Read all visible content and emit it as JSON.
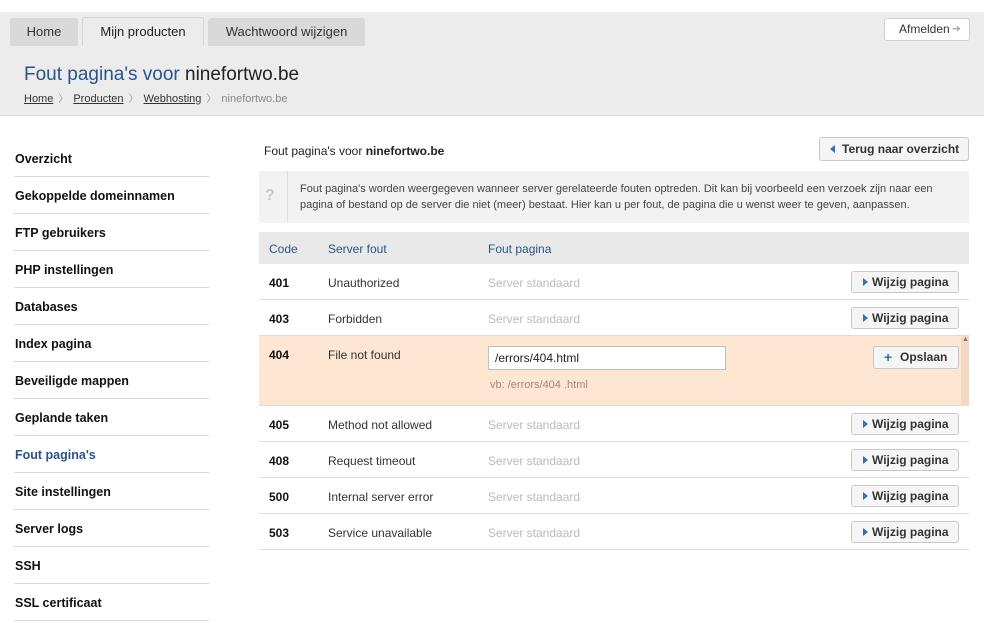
{
  "nav": {
    "tabs": [
      {
        "label": "Home"
      },
      {
        "label": "Mijn producten"
      },
      {
        "label": "Wachtwoord wijzigen"
      }
    ],
    "logout_label": "Afmelden"
  },
  "header": {
    "title_prefix": "Fout pagina's voor ",
    "title_domain": "ninefortwo.be",
    "breadcrumb": [
      "Home",
      "Producten",
      "Webhosting",
      "ninefortwo.be"
    ]
  },
  "sidebar": {
    "items": [
      {
        "label": "Overzicht"
      },
      {
        "label": "Gekoppelde domeinnamen"
      },
      {
        "label": "FTP gebruikers"
      },
      {
        "label": "PHP instellingen"
      },
      {
        "label": "Databases"
      },
      {
        "label": "Index pagina"
      },
      {
        "label": "Beveiligde mappen"
      },
      {
        "label": "Geplande taken"
      },
      {
        "label": "Fout pagina's"
      },
      {
        "label": "Site instellingen"
      },
      {
        "label": "Server logs"
      },
      {
        "label": "SSH"
      },
      {
        "label": "SSL certificaat"
      }
    ],
    "active_index": 8
  },
  "main": {
    "heading_prefix": "Fout pagina's voor ",
    "heading_domain": "ninefortwo.be",
    "back_label": "Terug naar overzicht",
    "info_text": "Fout pagina's worden weergegeven wanneer server gerelateerde fouten optreden. Dit kan bij voorbeeld een verzoek zijn naar een pagina of bestand op de server die niet (meer) bestaat. Hier kan u per fout, de pagina die u wenst weer te geven, aanpassen.",
    "info_icon": "?",
    "columns": [
      "Code",
      "Server fout",
      "Fout pagina"
    ],
    "rows": [
      {
        "code": "401",
        "error": "Unauthorized",
        "page": "Server standaard"
      },
      {
        "code": "403",
        "error": "Forbidden",
        "page": "Server standaard"
      },
      {
        "code": "405",
        "error": "Method not allowed",
        "page": "Server standaard"
      },
      {
        "code": "408",
        "error": "Request timeout",
        "page": "Server standaard"
      },
      {
        "code": "500",
        "error": "Internal server error",
        "page": "Server standaard"
      },
      {
        "code": "503",
        "error": "Service unavailable",
        "page": "Server standaard"
      }
    ],
    "edit_label": "Wijzig pagina",
    "editing_row": {
      "code": "404",
      "error": "File not found",
      "input_value": "/errors/404.html",
      "example": "vb: /errors/404 .html",
      "save_label": "Opslaan"
    }
  },
  "colors": {
    "accent": "#2a5488",
    "button_icon": "#2a73b8",
    "editing_row_bg": "#fde6d2"
  }
}
